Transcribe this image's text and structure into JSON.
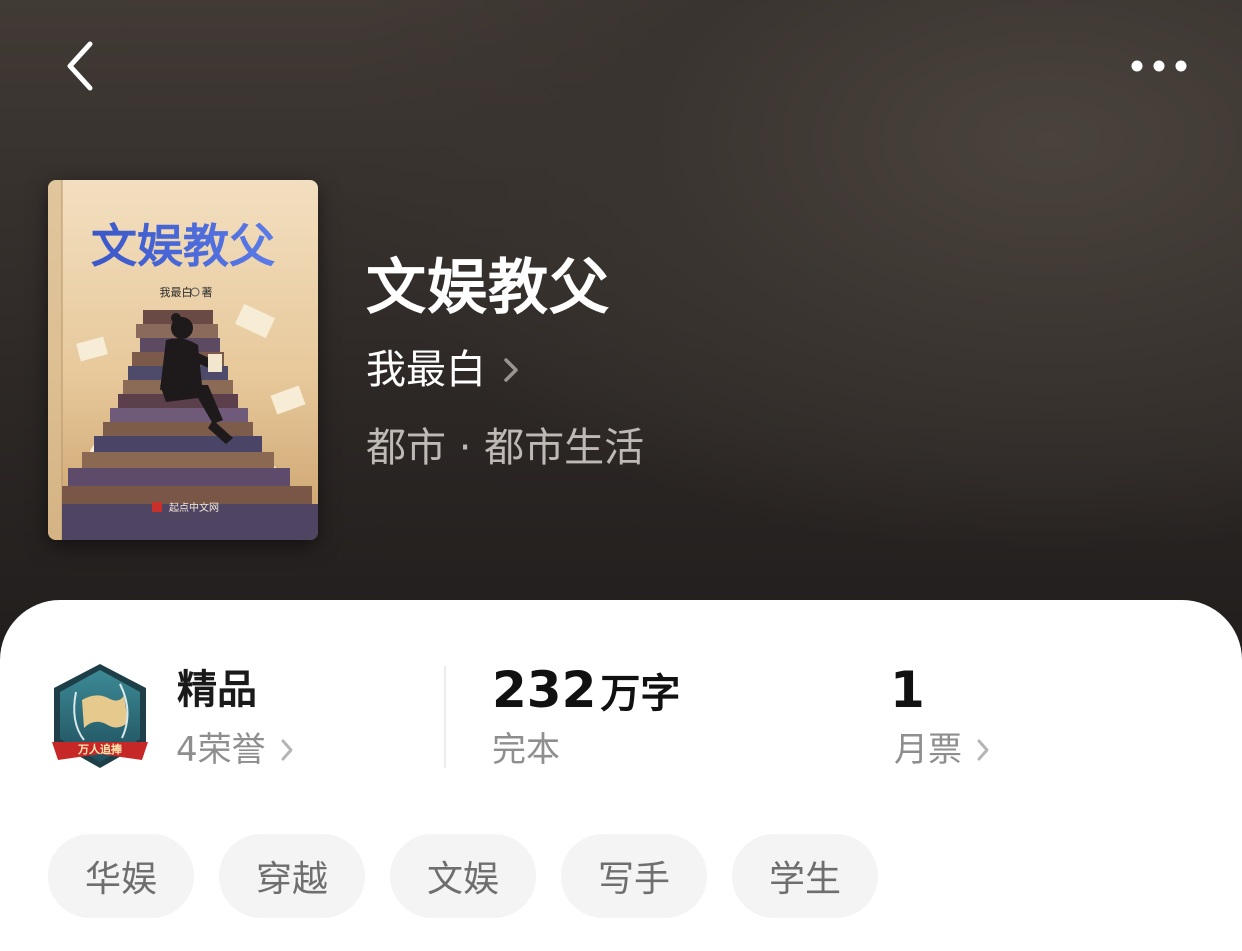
{
  "header": {
    "back_icon": "chevron-left-icon",
    "more_icon": "more-dots-icon"
  },
  "book": {
    "cover": {
      "title_art": "文娱教父",
      "author_art": "我最白",
      "author_suffix": "著",
      "publisher": "起点中文网"
    },
    "title": "文娱教父",
    "author": "我最白",
    "category": "都市 · 都市生活"
  },
  "stats": {
    "honor": {
      "title": "精品",
      "sub": "4荣誉",
      "badge_text": "万人追捧"
    },
    "words": {
      "number": "232",
      "unit": "万字",
      "status": "完本"
    },
    "ticket": {
      "number": "1",
      "label": "月票"
    }
  },
  "tags": [
    "华娱",
    "穿越",
    "文娱",
    "写手",
    "学生"
  ],
  "colors": {
    "hero_bg": "#2d2826",
    "card_bg": "#ffffff",
    "tag_bg": "#f4f4f4",
    "muted_text": "#8e8e8e"
  }
}
